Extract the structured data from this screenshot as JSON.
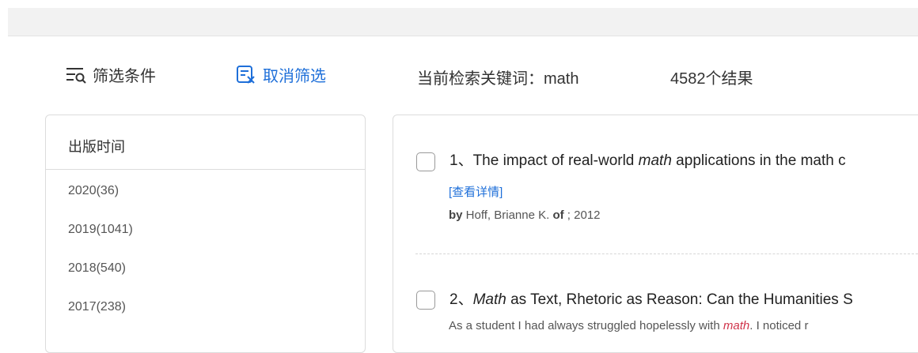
{
  "filter": {
    "title": "筛选条件",
    "cancel_label": "取消筛选",
    "keyword_label": "当前检索关键词：",
    "keyword_value": "math",
    "result_count": "4582个结果"
  },
  "sidebar": {
    "header": "出版时间",
    "years": [
      "2020(36)",
      "2019(1041)",
      "2018(540)",
      "2017(238)"
    ]
  },
  "results": [
    {
      "index": "1、",
      "title_pre": "The impact of real-world ",
      "title_em": "math",
      "title_post": " applications in the math c",
      "details": "[查看详情]",
      "by_label": "by",
      "author": " Hoff, Brianne K. ",
      "of_label": "of",
      "pub_info": " ; 2012"
    },
    {
      "index": "2、",
      "title_em": "Math",
      "title_post": " as Text, Rhetoric as Reason: Can the Humanities S",
      "snippet_pre": "As a student I had always struggled hopelessly with ",
      "snippet_hl": "math",
      "snippet_post": ". I noticed r"
    }
  ],
  "colors": {
    "link": "#1e6fd9",
    "highlight": "#d0334a",
    "topbar": "#f2f2f2"
  }
}
